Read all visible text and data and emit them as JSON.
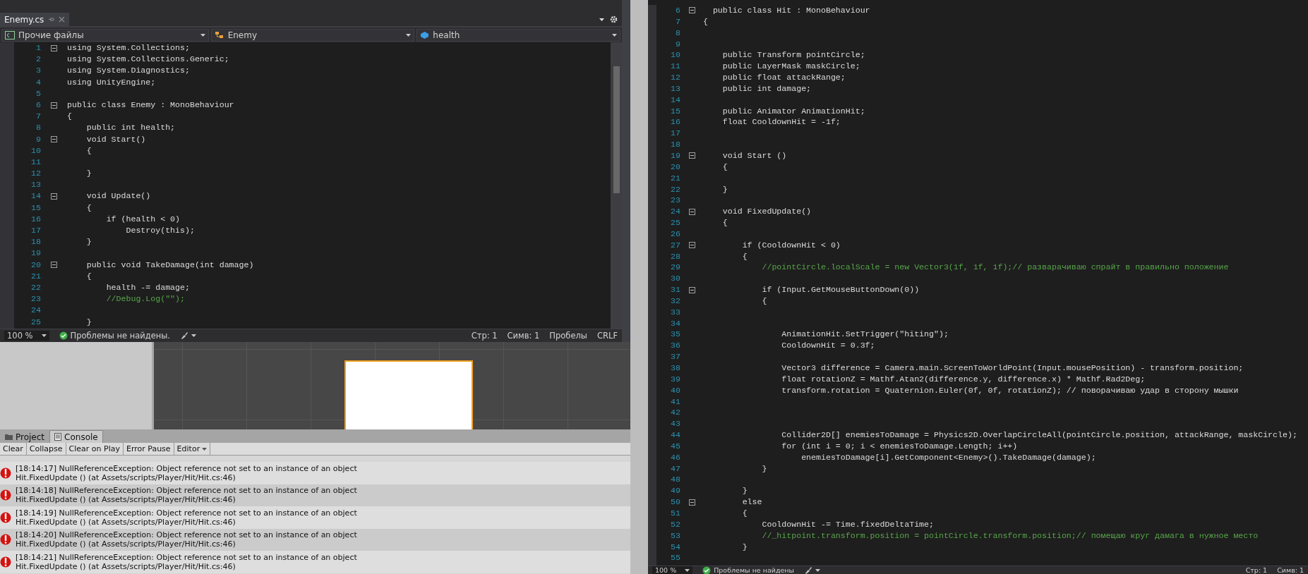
{
  "left_editor": {
    "tabs": [
      {
        "label": "Enemy.cs",
        "selected": true
      }
    ],
    "nav": [
      {
        "kind": "project",
        "label": "Прочие файлы"
      },
      {
        "kind": "class",
        "label": "Enemy"
      },
      {
        "kind": "member",
        "label": "health"
      }
    ],
    "lines": [
      {
        "n": "1",
        "fold": true,
        "kind": "code",
        "text": "using System.Collections;"
      },
      {
        "n": "2",
        "fold": false,
        "kind": "code",
        "text": "using System.Collections.Generic;"
      },
      {
        "n": "3",
        "fold": false,
        "kind": "code",
        "text": "using System.Diagnostics;"
      },
      {
        "n": "4",
        "fold": false,
        "kind": "code",
        "text": "using UnityEngine;"
      },
      {
        "n": "5",
        "fold": false
      },
      {
        "n": "6",
        "fold": true,
        "kind": "code",
        "text": "public class Enemy : MonoBehaviour"
      },
      {
        "n": "7",
        "fold": false,
        "kind": "code",
        "text": "{"
      },
      {
        "n": "8",
        "fold": false,
        "kind": "code",
        "text": "    public int health;"
      },
      {
        "n": "9",
        "fold": true,
        "kind": "code",
        "text": "    void Start()"
      },
      {
        "n": "10",
        "fold": false,
        "kind": "code",
        "text": "    {"
      },
      {
        "n": "11",
        "fold": false
      },
      {
        "n": "12",
        "fold": false,
        "kind": "code",
        "text": "    }"
      },
      {
        "n": "13",
        "fold": false
      },
      {
        "n": "14",
        "fold": true,
        "kind": "code",
        "text": "    void Update()"
      },
      {
        "n": "15",
        "fold": false,
        "kind": "code",
        "text": "    {"
      },
      {
        "n": "16",
        "fold": false,
        "kind": "code",
        "text": "        if (health < 0)"
      },
      {
        "n": "17",
        "fold": false,
        "kind": "code",
        "text": "            Destroy(this);"
      },
      {
        "n": "18",
        "fold": false,
        "kind": "code",
        "text": "    }"
      },
      {
        "n": "19",
        "fold": false
      },
      {
        "n": "20",
        "fold": true,
        "kind": "code",
        "text": "    public void TakeDamage(int damage)"
      },
      {
        "n": "21",
        "fold": false,
        "kind": "code",
        "text": "    {"
      },
      {
        "n": "22",
        "fold": false,
        "kind": "code",
        "text": "        health -= damage;"
      },
      {
        "n": "23",
        "fold": false,
        "kind": "comment",
        "text": "        //Debug.Log(\"\");"
      },
      {
        "n": "24",
        "fold": false
      },
      {
        "n": "25",
        "fold": false,
        "kind": "code",
        "text": "    }"
      }
    ],
    "status": {
      "zoom": "100 %",
      "problems": "Проблемы не найдены.",
      "line": "Стр: 1",
      "col": "Симв: 1",
      "spaces": "Пробелы",
      "eol": "CRLF"
    }
  },
  "console": {
    "tabs": [
      {
        "kind": "project",
        "label": "Project",
        "selected": false
      },
      {
        "kind": "console",
        "label": "Console",
        "selected": true
      }
    ],
    "toolbar": [
      {
        "kind": "button",
        "label": "Clear"
      },
      {
        "kind": "button",
        "label": "Collapse"
      },
      {
        "kind": "button",
        "label": "Clear on Play"
      },
      {
        "kind": "button",
        "label": "Error Pause"
      },
      {
        "kind": "menu",
        "label": "Editor"
      }
    ],
    "entries": [
      {
        "message": "[18:14:17] NullReferenceException: Object reference not set to an instance of an object",
        "trace": "Hit.FixedUpdate () (at Assets/scripts/Player/Hit/Hit.cs:46)"
      },
      {
        "message": "[18:14:18] NullReferenceException: Object reference not set to an instance of an object",
        "trace": "Hit.FixedUpdate () (at Assets/scripts/Player/Hit/Hit.cs:46)"
      },
      {
        "message": "[18:14:19] NullReferenceException: Object reference not set to an instance of an object",
        "trace": "Hit.FixedUpdate () (at Assets/scripts/Player/Hit/Hit.cs:46)"
      },
      {
        "message": "[18:14:20] NullReferenceException: Object reference not set to an instance of an object",
        "trace": "Hit.FixedUpdate () (at Assets/scripts/Player/Hit/Hit.cs:46)"
      },
      {
        "message": "[18:14:21] NullReferenceException: Object reference not set to an instance of an object",
        "trace": "Hit.FixedUpdate () (at Assets/scripts/Player/Hit/Hit.cs:46)"
      }
    ]
  },
  "right_editor": {
    "lines": [
      {
        "n": "6",
        "fold": true,
        "kind": "code",
        "text": "  public class Hit : MonoBehaviour"
      },
      {
        "n": "7",
        "fold": false,
        "kind": "code",
        "text": "{"
      },
      {
        "n": "8",
        "fold": false
      },
      {
        "n": "9",
        "fold": false
      },
      {
        "n": "10",
        "fold": false,
        "kind": "code",
        "text": "    public Transform pointCircle;"
      },
      {
        "n": "11",
        "fold": false,
        "kind": "code",
        "text": "    public LayerMask maskCircle;"
      },
      {
        "n": "12",
        "fold": false,
        "kind": "code",
        "text": "    public float attackRange;"
      },
      {
        "n": "13",
        "fold": false,
        "kind": "code",
        "text": "    public int damage;"
      },
      {
        "n": "14",
        "fold": false
      },
      {
        "n": "15",
        "fold": false,
        "kind": "code",
        "text": "    public Animator AnimationHit;"
      },
      {
        "n": "16",
        "fold": false,
        "kind": "code",
        "text": "    float CooldownHit = -1f;"
      },
      {
        "n": "17",
        "fold": false
      },
      {
        "n": "18",
        "fold": false
      },
      {
        "n": "19",
        "fold": true,
        "kind": "code",
        "text": "    void Start ()"
      },
      {
        "n": "20",
        "fold": false,
        "kind": "code",
        "text": "    {"
      },
      {
        "n": "21",
        "fold": false
      },
      {
        "n": "22",
        "fold": false,
        "kind": "code",
        "text": "    }"
      },
      {
        "n": "23",
        "fold": false
      },
      {
        "n": "24",
        "fold": true,
        "kind": "code",
        "text": "    void FixedUpdate()"
      },
      {
        "n": "25",
        "fold": false,
        "kind": "code",
        "text": "    {"
      },
      {
        "n": "26",
        "fold": false
      },
      {
        "n": "27",
        "fold": true,
        "kind": "code",
        "text": "        if (CooldownHit < 0)"
      },
      {
        "n": "28",
        "fold": false,
        "kind": "code",
        "text": "        {"
      },
      {
        "n": "29",
        "fold": false,
        "kind": "comment",
        "text": "            //pointCircle.localScale = new Vector3(1f, 1f, 1f);// разварачиваю спрайт в правильно положение"
      },
      {
        "n": "30",
        "fold": false
      },
      {
        "n": "31",
        "fold": true,
        "kind": "code",
        "text": "            if (Input.GetMouseButtonDown(0))"
      },
      {
        "n": "32",
        "fold": false,
        "kind": "code",
        "text": "            {"
      },
      {
        "n": "33",
        "fold": false
      },
      {
        "n": "34",
        "fold": false
      },
      {
        "n": "35",
        "fold": false,
        "kind": "code",
        "text": "                AnimationHit.SetTrigger(\"hiting\");"
      },
      {
        "n": "36",
        "fold": false,
        "kind": "code",
        "text": "                CooldownHit = 0.3f;"
      },
      {
        "n": "37",
        "fold": false
      },
      {
        "n": "38",
        "fold": false,
        "kind": "code",
        "text": "                Vector3 difference = Camera.main.ScreenToWorldPoint(Input.mousePosition) - transform.position;"
      },
      {
        "n": "39",
        "fold": false,
        "kind": "code",
        "text": "                float rotationZ = Mathf.Atan2(difference.y, difference.x) * Mathf.Rad2Deg;"
      },
      {
        "n": "40",
        "fold": false,
        "kind": "code",
        "text": "                transform.rotation = Quaternion.Euler(0f, 0f, rotationZ); // поворачиваю удар в сторону мышки"
      },
      {
        "n": "41",
        "fold": false
      },
      {
        "n": "42",
        "fold": false
      },
      {
        "n": "43",
        "fold": false
      },
      {
        "n": "44",
        "fold": false,
        "kind": "code",
        "text": "                Collider2D[] enemiesToDamage = Physics2D.OverlapCircleAll(pointCircle.position, attackRange, maskCircle);"
      },
      {
        "n": "45",
        "fold": false,
        "kind": "code",
        "text": "                for (int i = 0; i < enemiesToDamage.Length; i++)"
      },
      {
        "n": "46",
        "fold": false,
        "kind": "code",
        "text": "                    enemiesToDamage[i].GetComponent<Enemy>().TakeDamage(damage);"
      },
      {
        "n": "47",
        "fold": false,
        "kind": "code",
        "text": "            }"
      },
      {
        "n": "48",
        "fold": false
      },
      {
        "n": "49",
        "fold": false,
        "kind": "code",
        "text": "        }"
      },
      {
        "n": "50",
        "fold": true,
        "kind": "code",
        "text": "        else"
      },
      {
        "n": "51",
        "fold": false,
        "kind": "code",
        "text": "        {"
      },
      {
        "n": "52",
        "fold": false,
        "kind": "code",
        "text": "            CooldownHit -= Time.fixedDeltaTime;"
      },
      {
        "n": "53",
        "fold": false,
        "kind": "comment",
        "text": "            //_hitpoint.transform.position = pointCircle.transform.position;// помещаю круг дамага в нужное место"
      },
      {
        "n": "54",
        "fold": false,
        "kind": "code",
        "text": "        }"
      },
      {
        "n": "55",
        "fold": false
      }
    ],
    "status": {
      "zoom": "100 %",
      "problems": "Проблемы не найдены",
      "line": "Стр: 1",
      "col": "Симв: 1"
    }
  }
}
